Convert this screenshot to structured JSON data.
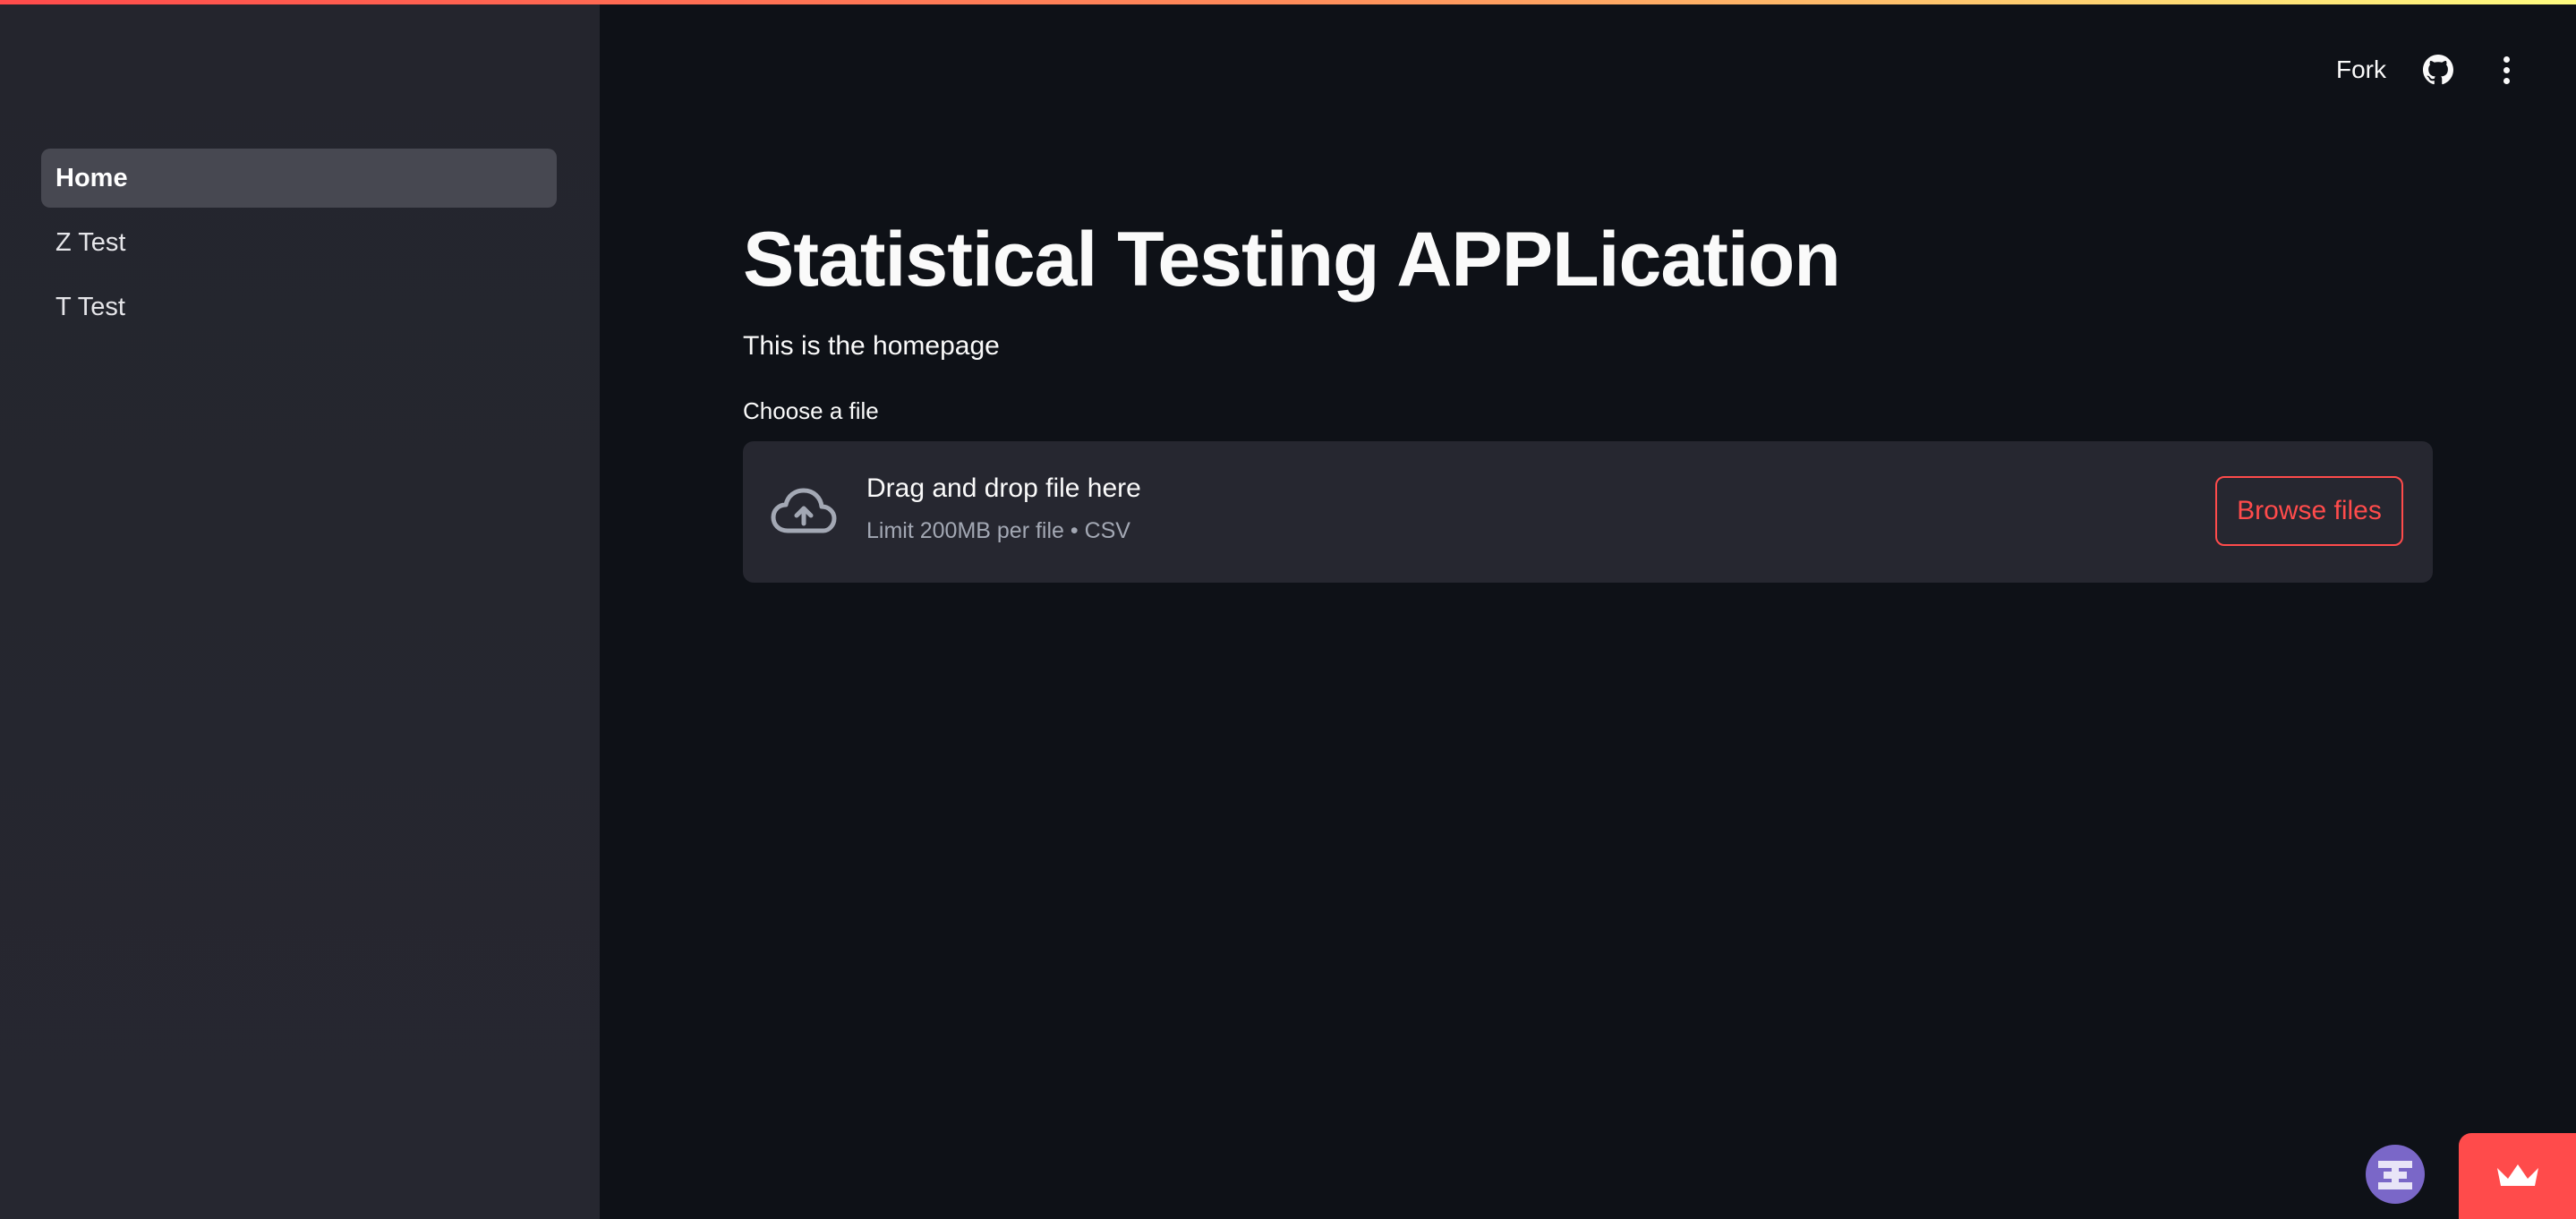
{
  "sidebar": {
    "items": [
      {
        "label": "Home",
        "active": true
      },
      {
        "label": "Z Test",
        "active": false
      },
      {
        "label": "T Test",
        "active": false
      }
    ]
  },
  "header": {
    "fork_label": "Fork",
    "github_icon": "github-icon",
    "menu_icon": "kebab-menu-icon"
  },
  "main": {
    "title": "Statistical Testing APPLication",
    "subtitle": "This is the homepage",
    "uploader": {
      "label": "Choose a file",
      "drop_text": "Drag and drop file here",
      "limit_text": "Limit 200MB per file • CSV",
      "button_label": "Browse files",
      "icon": "cloud-upload-icon"
    }
  },
  "colors": {
    "accent": "#ff4b4b",
    "background": "#0e1117",
    "sidebar": "#262730",
    "active_nav": "#474851"
  }
}
